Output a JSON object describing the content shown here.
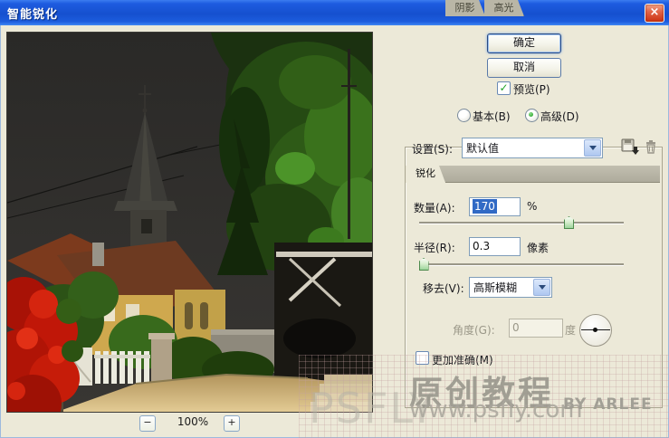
{
  "window": {
    "title": "智能锐化",
    "close_glyph": "×"
  },
  "actions": {
    "ok": "确定",
    "cancel": "取消"
  },
  "preview_option": {
    "label": "预览(P)",
    "checked": true,
    "check_glyph": "✓"
  },
  "mode": {
    "basic_label": "基本(B)",
    "basic_checked": false,
    "advanced_label": "高级(D)",
    "advanced_checked": true
  },
  "settings": {
    "label": "设置(S):",
    "value": "默认值"
  },
  "tabs": {
    "sharpen": "锐化",
    "shadow": "阴影",
    "highlight": "高光",
    "active": "锐化"
  },
  "sharpen": {
    "amount_label": "数量(A):",
    "amount_value": "170",
    "amount_unit": "%",
    "amount_slider_pct": 73,
    "radius_label": "半径(R):",
    "radius_value": "0.3",
    "radius_unit": "像素",
    "radius_slider_pct": 2,
    "remove_label": "移去(V):",
    "remove_value": "高斯模糊",
    "angle_label": "角度(G):",
    "angle_value": "0",
    "angle_unit": "度",
    "angle_disabled": true,
    "more_accurate_label": "更加准确(M)",
    "more_accurate_checked": false
  },
  "zoom_controls": {
    "minus": "−",
    "level": "100%",
    "plus": "+"
  },
  "watermark": {
    "psfly": "PSFLY",
    "headline": "原创教程",
    "url": "www.psfly.com",
    "byline": "BY ARLEE"
  },
  "icons": {
    "save": "save-settings-icon",
    "delete": "delete-settings-icon"
  },
  "colors": {
    "titlebar_blue": "#1a55d9",
    "dialog_bg": "#ece9d8",
    "selection_blue": "#316ac5",
    "slider_thumb_green": "#93d193",
    "close_button_red": "#d9512c",
    "check_green": "#21a528"
  }
}
